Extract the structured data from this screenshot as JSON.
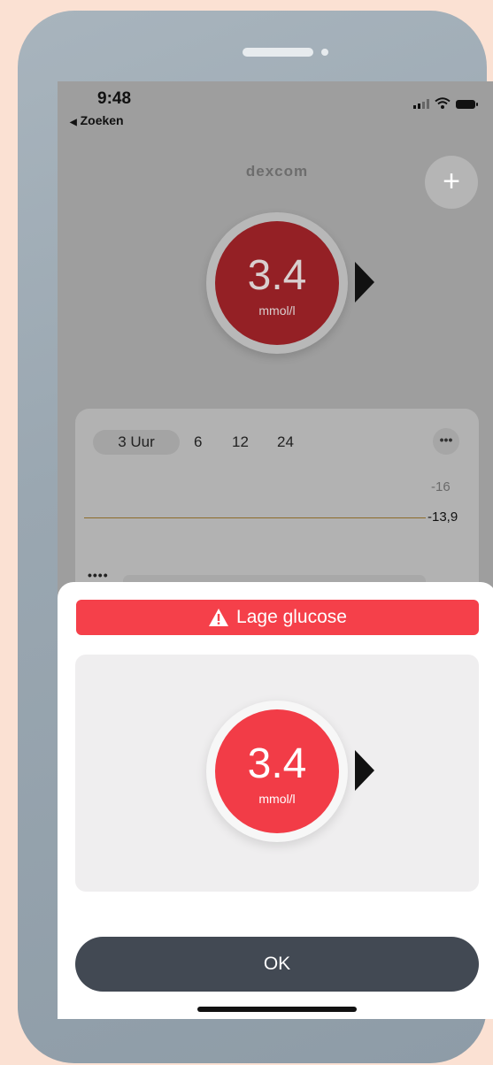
{
  "status": {
    "time": "9:48",
    "back": "Zoeken"
  },
  "header": {
    "brand": "Dexcom",
    "add_label": "+"
  },
  "reading": {
    "value": "3.4",
    "unit": "mmol/l"
  },
  "graph": {
    "tabs": [
      "3 Uur",
      "6",
      "12",
      "24"
    ],
    "more_label": "•••",
    "ticks": [
      "16",
      "13,9"
    ],
    "progress_dots": "••••"
  },
  "alert": {
    "title": "Lage glucose",
    "value": "3.4",
    "unit": "mmol/l",
    "ok_label": "OK"
  },
  "colors": {
    "alert_red": "#f5404a",
    "gauge_red": "#f23c47",
    "button_dark": "#424953",
    "threshold_line": "#8c6b2a"
  }
}
